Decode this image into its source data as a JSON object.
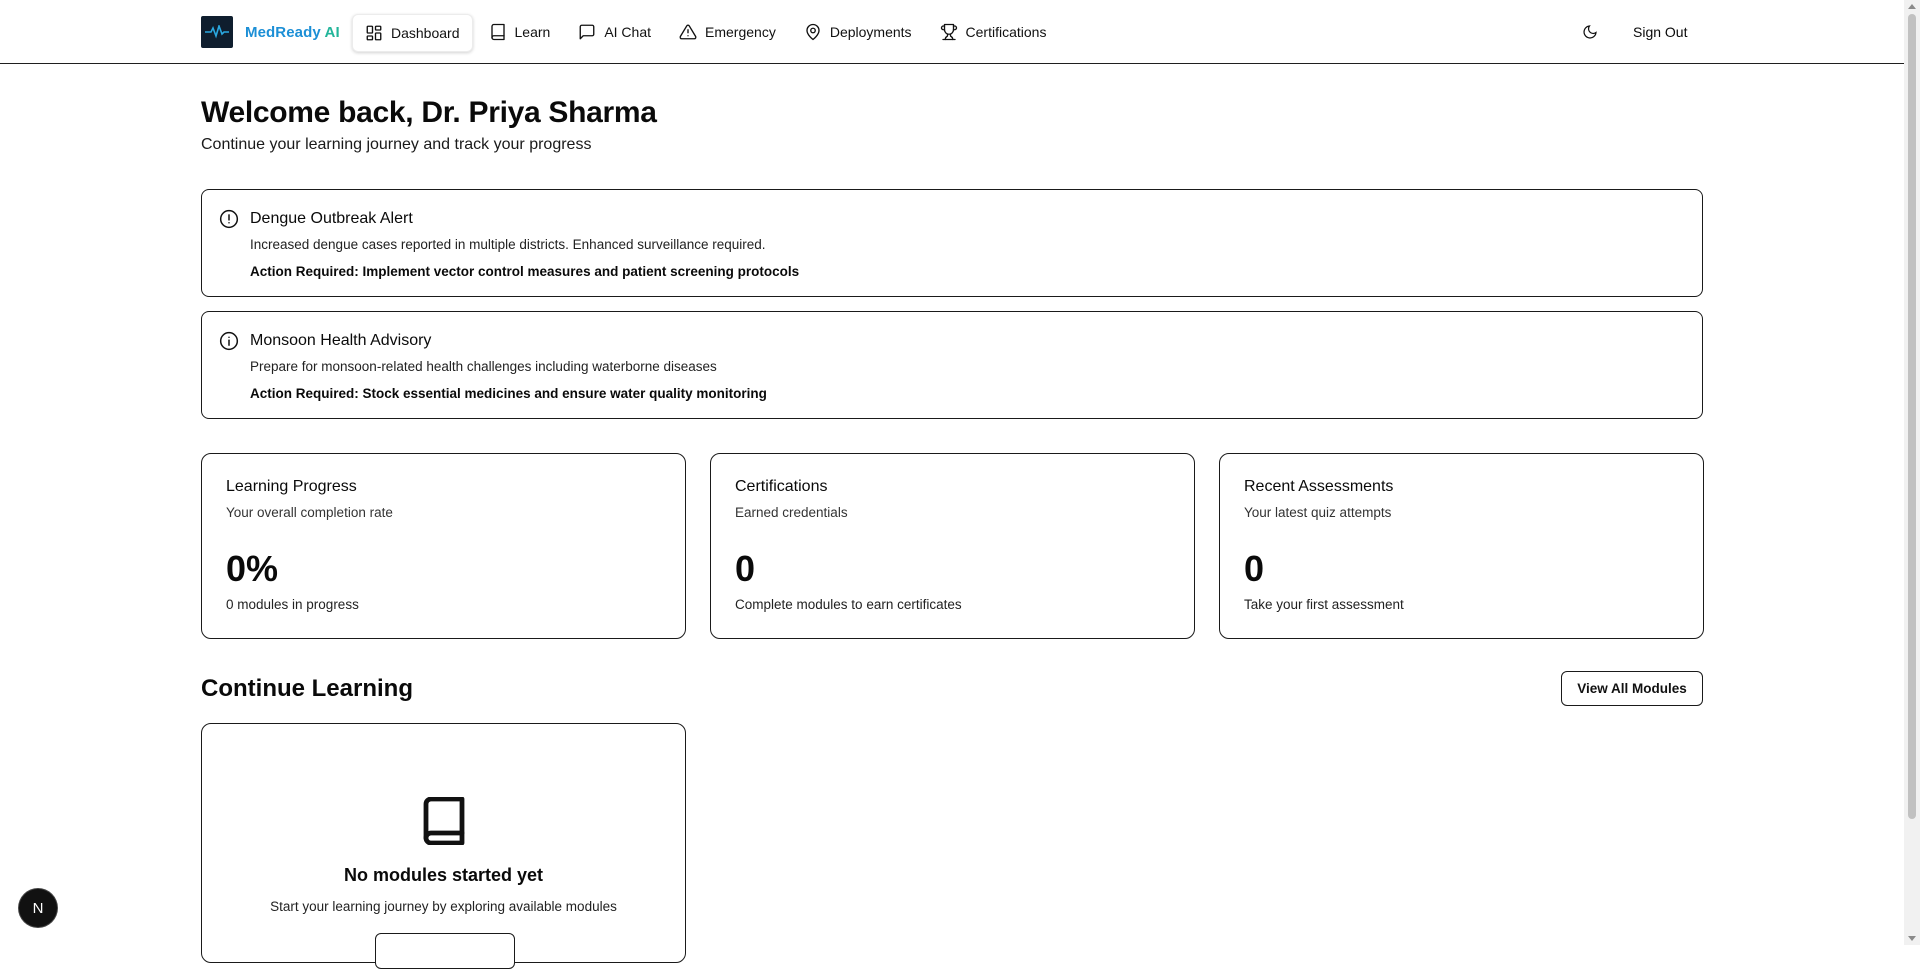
{
  "header": {
    "brand": {
      "name_part1": "MedReady",
      "name_part2": "AI"
    },
    "nav": [
      {
        "label": "Dashboard",
        "icon": "dashboard-grid-icon",
        "active": true
      },
      {
        "label": "Learn",
        "icon": "book-icon"
      },
      {
        "label": "AI Chat",
        "icon": "chat-bubble-icon"
      },
      {
        "label": "Emergency",
        "icon": "warning-triangle-icon"
      },
      {
        "label": "Deployments",
        "icon": "map-pin-icon"
      },
      {
        "label": "Certifications",
        "icon": "trophy-icon"
      }
    ],
    "theme_toggle_icon": "moon-icon",
    "sign_out_label": "Sign Out"
  },
  "welcome": {
    "title": "Welcome back, Dr. Priya Sharma",
    "subtitle": "Continue your learning journey and track your progress"
  },
  "alerts": [
    {
      "icon": "alert-circle-icon",
      "title": "Dengue Outbreak Alert",
      "description": "Increased dengue cases reported in multiple districts. Enhanced surveillance required.",
      "action": "Action Required: Implement vector control measures and patient screening protocols"
    },
    {
      "icon": "info-circle-icon",
      "title": "Monsoon Health Advisory",
      "description": "Prepare for monsoon-related health challenges including waterborne diseases",
      "action": "Action Required: Stock essential medicines and ensure water quality monitoring"
    }
  ],
  "stats": [
    {
      "title": "Learning Progress",
      "description": "Your overall completion rate",
      "value": "0%",
      "note": "0 modules in progress"
    },
    {
      "title": "Certifications",
      "description": "Earned credentials",
      "value": "0",
      "note": "Complete modules to earn certificates"
    },
    {
      "title": "Recent Assessments",
      "description": "Your latest quiz attempts",
      "value": "0",
      "note": "Take your first assessment"
    }
  ],
  "continue_learning": {
    "title": "Continue Learning",
    "view_all_label": "View All Modules",
    "empty": {
      "icon": "book-icon",
      "title": "No modules started yet",
      "description": "Start your learning journey by exploring available modules"
    }
  },
  "dev_badge": {
    "letter": "N"
  },
  "colors": {
    "brand_blue": "#1c8fd6",
    "brand_green": "#22b59a",
    "border": "#1a1a1a"
  }
}
